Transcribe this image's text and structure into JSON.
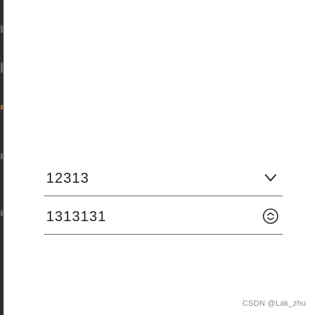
{
  "rows": [
    {
      "value": "12313",
      "icon": "chevron-down-icon"
    },
    {
      "value": "1313131",
      "icon": "circle-up-down-icon"
    }
  ],
  "watermark": {
    "text": "CSDN @Lak_zhu"
  },
  "colors": {
    "text": "#1e1e1e",
    "divider": "#6b6b6b",
    "icon": "#2a2a2a",
    "watermark": "#8c8c8c"
  }
}
